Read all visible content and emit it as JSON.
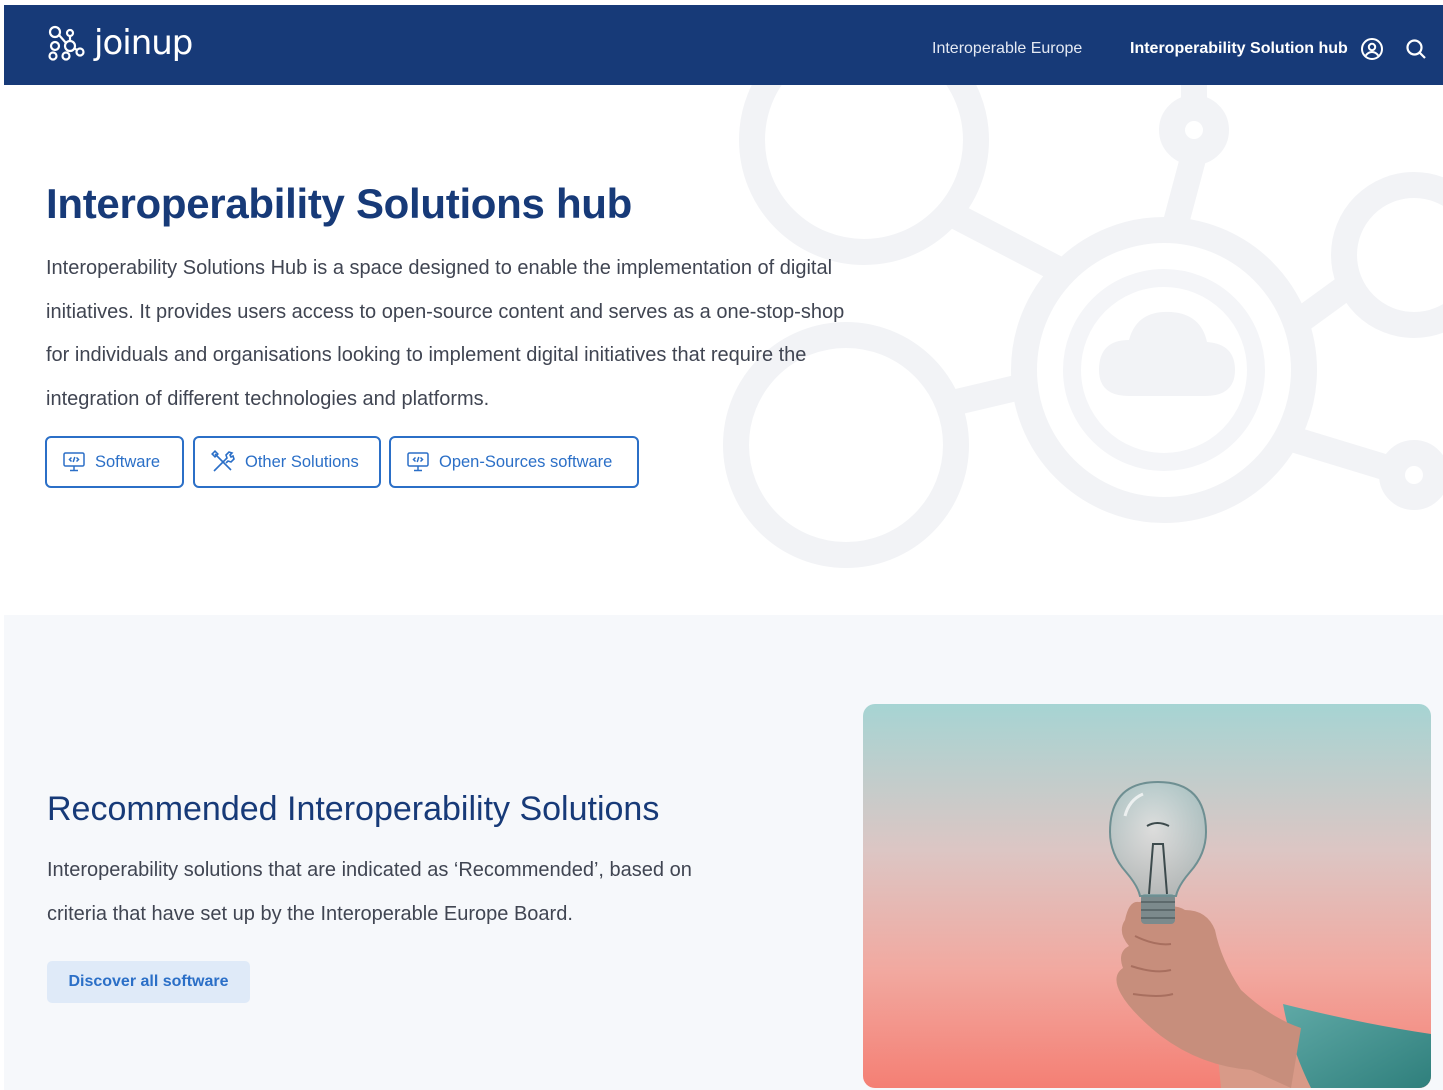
{
  "header": {
    "logo_text": "joinup",
    "nav": [
      {
        "label": "Interoperable Europe"
      },
      {
        "label": "Interoperability Solution hub"
      }
    ],
    "icons": [
      "user-circle-icon",
      "search-icon"
    ]
  },
  "hero": {
    "title": "Interoperability Solutions hub",
    "description": "Interoperability Solutions Hub is a space designed to enable the implementation of digital initiatives. It provides users access to open-source content and serves as a one-stop-shop for individuals and organisations looking to implement digital initiatives that require the integration of different technologies and platforms.",
    "buttons": [
      {
        "label": "Software",
        "icon": "monitor-code-icon"
      },
      {
        "label": "Other Solutions",
        "icon": "tools-icon"
      },
      {
        "label": "Open-Sources software",
        "icon": "monitor-code-icon"
      }
    ]
  },
  "recommended": {
    "title": "Recommended Interoperability Solutions",
    "description": "Interoperability solutions that are indicated as ‘Recommended’, based on criteria that have set up by the Interoperable Europe Board.",
    "button_label": "Discover all software",
    "image": "lightbulb-in-hand-photo"
  },
  "colors": {
    "brand": "#173a78",
    "accent": "#2b6fc7",
    "text": "#404552",
    "soft_button_bg": "#dfeaf8",
    "section_bg": "#f6f8fb"
  }
}
